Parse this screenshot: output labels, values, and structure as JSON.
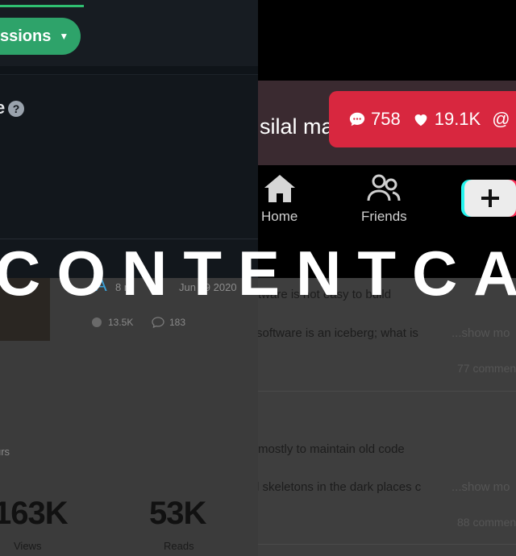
{
  "overlay_title": "CONTENTCA",
  "top_left": {
    "pill_label": "ssions",
    "panel_partial_letter": "e",
    "help_icon": "?"
  },
  "top_right": {
    "banner_text": "silal ma",
    "stats": {
      "comments": "758",
      "likes": "19.1K",
      "at_symbol": "@"
    },
    "nav": {
      "home": "Home",
      "friends": "Friends",
      "plus": "+"
    }
  },
  "bottom_left": {
    "meta_left": "8 m",
    "meta_right": "Jun 19 2020",
    "likes": "13.5K",
    "comments": "183",
    "hours_label": "urs",
    "views_value": "163K",
    "views_label": "Views",
    "reads_value": "53K",
    "reads_label": "Reads",
    "partial_letter": "A"
  },
  "bottom_right": {
    "posts": [
      {
        "title": "tware is not easy to build",
        "excerpt": "software is an iceberg; what is",
        "more": "...show mo",
        "comments": "77 commen"
      },
      {
        "title": "mostly to maintain old code",
        "excerpt": "l skeletons in the dark places c",
        "more": "...show mo",
        "comments": "88 commen"
      }
    ]
  },
  "colors": {
    "green": "#2ea36a",
    "tiktok_red": "#d8273f",
    "cyan": "#25f4ee",
    "pink": "#fe2c55"
  }
}
